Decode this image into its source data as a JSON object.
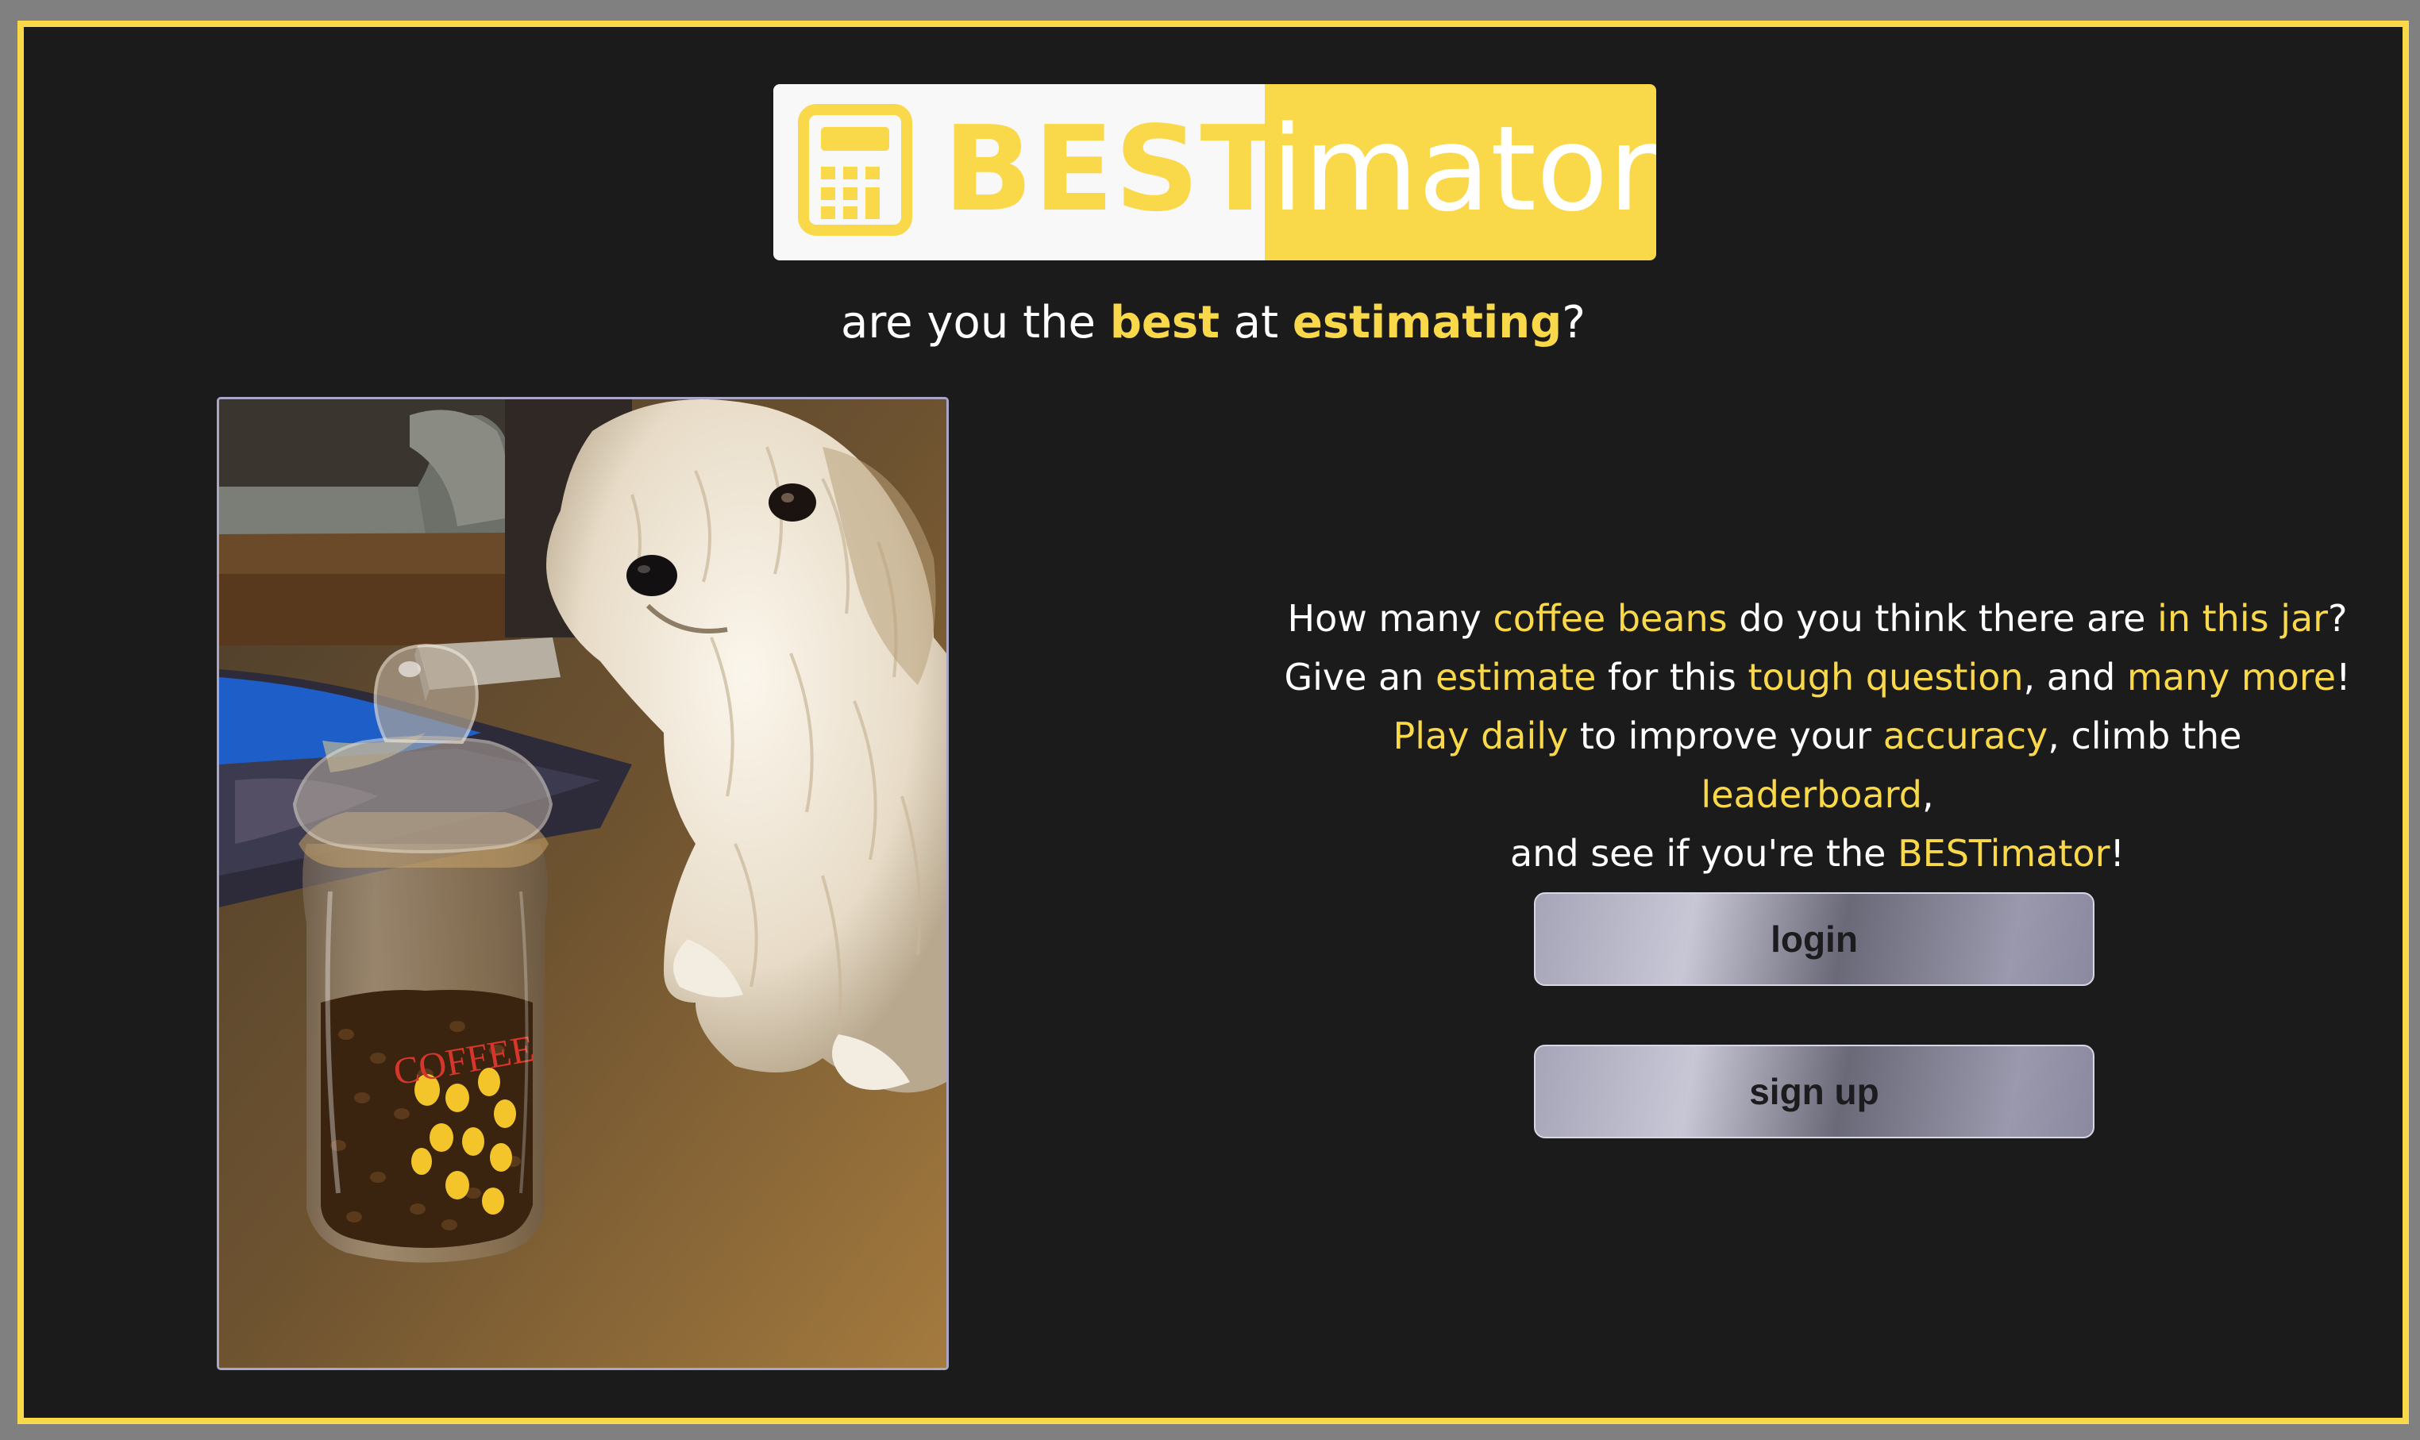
{
  "logo": {
    "part1": "BEST",
    "part2": "imator",
    "icon": "calculator-icon",
    "colors": {
      "yellow": "#f9d84a",
      "white": "#f8f8f8"
    }
  },
  "tagline": {
    "t1": "are you the ",
    "best": "best",
    "t2": " at ",
    "estimating": "estimating",
    "t3": "?"
  },
  "description": {
    "line1": {
      "a": "How many ",
      "b": "coffee beans",
      "c": " do you think there are ",
      "d": "in this jar",
      "e": "?"
    },
    "line2": {
      "a": "Give an ",
      "b": "estimate",
      "c": " for this ",
      "d": "tough question",
      "e": ", and ",
      "f": "many more",
      "g": "!"
    },
    "line3": {
      "a": "Play daily",
      "b": " to improve your ",
      "c": "accuracy",
      "d": ", climb the ",
      "e": "leaderboard",
      "f": ","
    },
    "line4": {
      "a": "and see if you're the ",
      "b": "BESTimator",
      "c": "!"
    }
  },
  "buttons": {
    "login": "login",
    "signup": "sign up"
  },
  "photo": {
    "jar_label": "COFFEE"
  },
  "colors": {
    "background": "#1b1b1c",
    "frame_border": "#f9d84a",
    "outer": "#808080",
    "accent": "#f9d84a"
  }
}
